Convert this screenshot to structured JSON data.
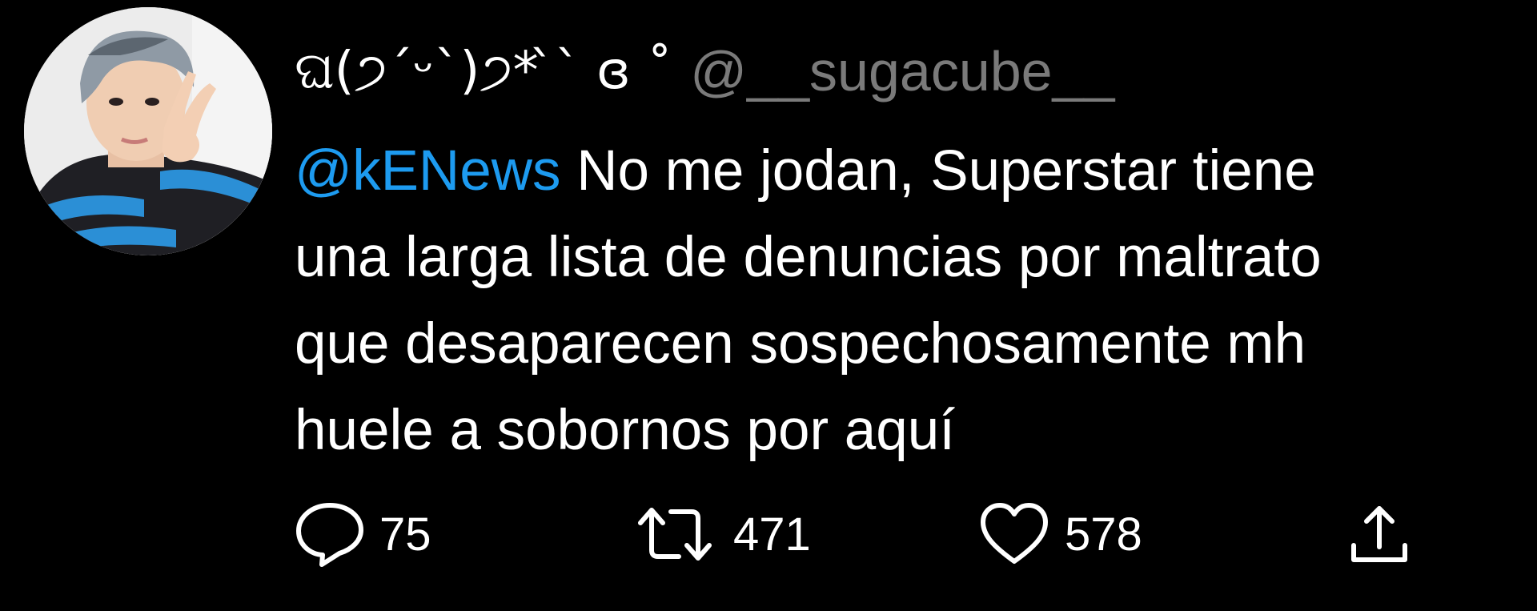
{
  "author": {
    "display_name": "ଘ(੭ˊᵕˋ)੭* ̀ˋ ɞ ˚",
    "handle": "@__sugacube__"
  },
  "tweet": {
    "mention": "@kENews",
    "lines": [
      " No me jodan, Superstar tiene",
      "una larga lista de denuncias por maltrato",
      "que desaparecen sospechosamente mh",
      "huele a sobornos por aquí"
    ]
  },
  "actions": {
    "replies": "75",
    "retweets": "471",
    "likes": "578"
  },
  "icons": {
    "reply": "speech-bubble-icon",
    "retweet": "retweet-arrows-icon",
    "like": "heart-icon",
    "share": "share-upload-icon"
  },
  "colors": {
    "background": "#000000",
    "text": "#ffffff",
    "handle": "#7a7a7a",
    "mention": "#1d9bf0"
  }
}
